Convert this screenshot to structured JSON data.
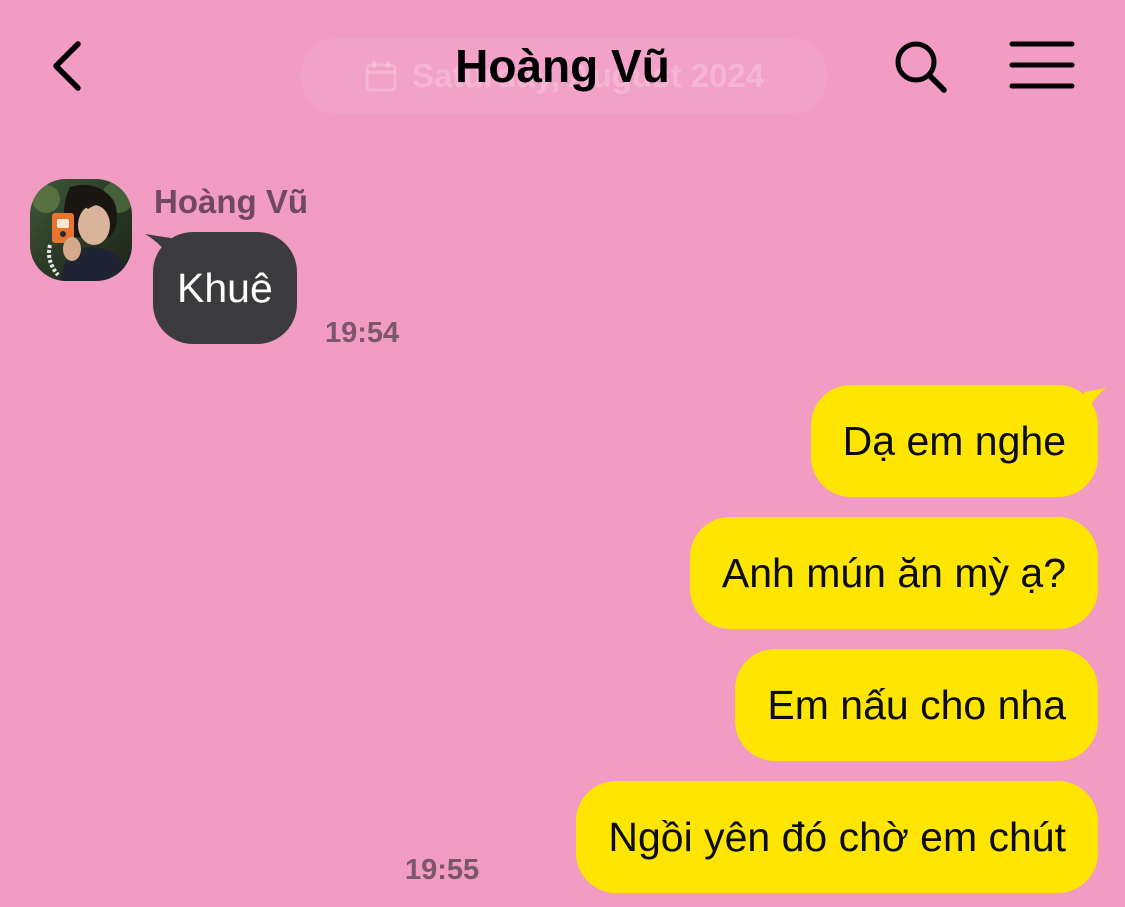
{
  "header": {
    "back_icon": "chevron-left-icon",
    "title": "Hoàng Vũ",
    "date_pill": "Saturday, August 2024",
    "date_icon": "calendar-icon",
    "search_icon": "search-icon",
    "menu_icon": "hamburger-menu-icon"
  },
  "incoming": {
    "sender": "Hoàng Vũ",
    "text": "Khuê",
    "time": "19:54"
  },
  "outgoing": {
    "messages": [
      "Dạ em nghe",
      "Anh mún ăn mỳ ạ?",
      "Em nấu cho nha",
      "Ngồi yên đó chờ em chút"
    ],
    "time": "19:55"
  },
  "colors": {
    "background": "#f29bc3",
    "incoming_bubble": "#3b3b3d",
    "outgoing_bubble": "#ffe502"
  }
}
